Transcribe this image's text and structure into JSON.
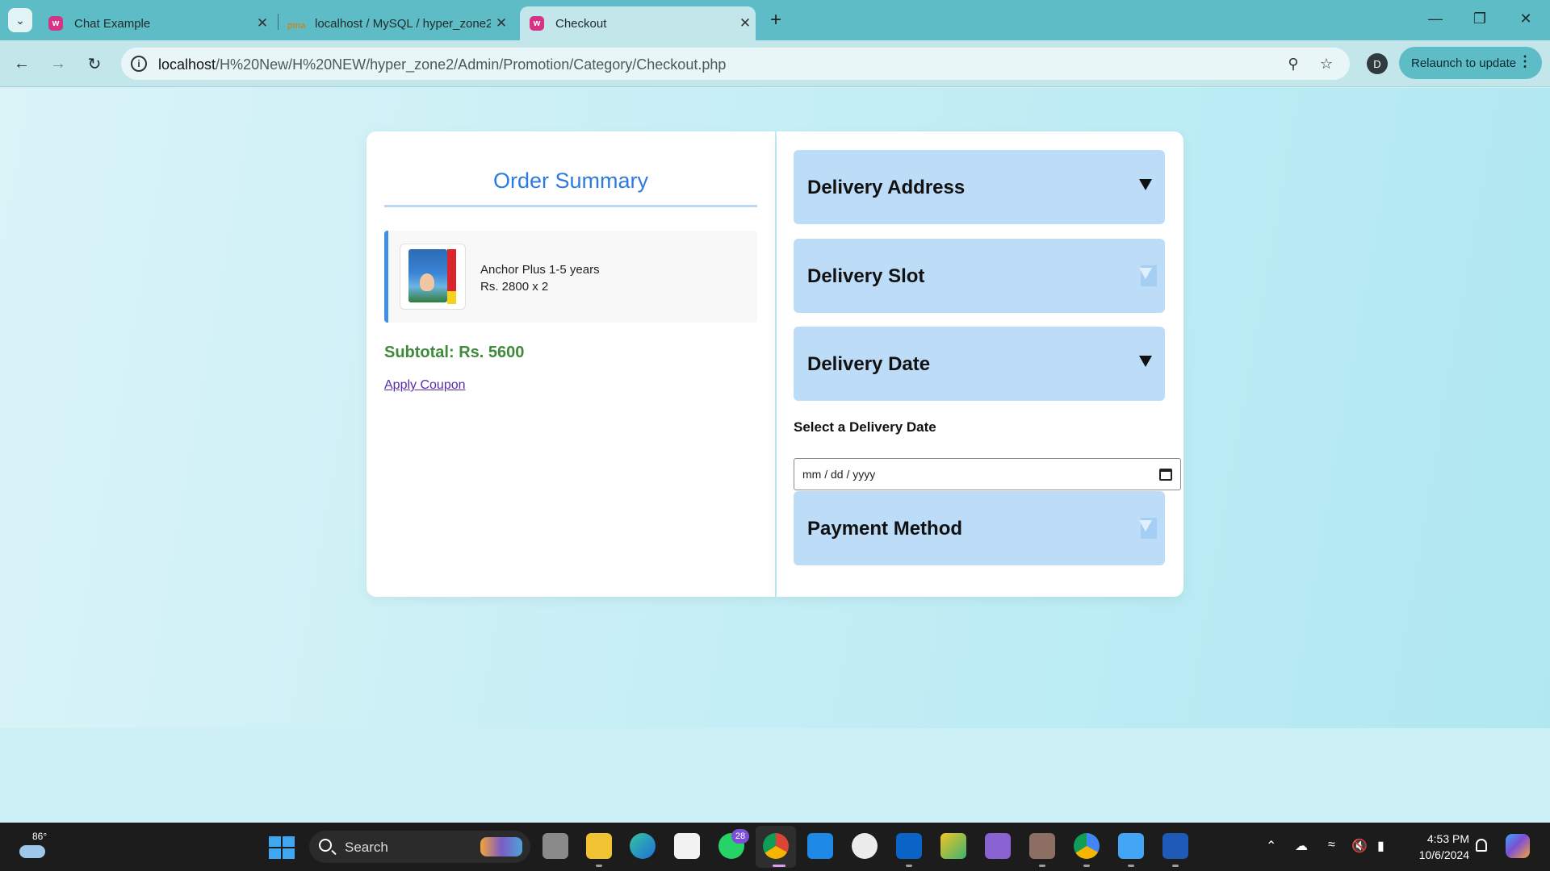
{
  "browser": {
    "tabs": [
      {
        "title": "Chat Example",
        "active": false
      },
      {
        "title": "localhost / MySQL / hyper_zone2",
        "active": false
      },
      {
        "title": "Checkout",
        "active": true
      }
    ],
    "url_host": "localhost",
    "url_path": "/H%20New/H%20NEW/hyper_zone2/Admin/Promotion/Category/Checkout.php",
    "profile_initial": "D",
    "relaunch_label": "Relaunch to update",
    "icons": {
      "menu": "chevron-down-icon",
      "new_tab": "plus-icon",
      "zoom": "zoom-icon",
      "bookmark": "star-icon",
      "more": "kebab-icon"
    }
  },
  "order_summary": {
    "title": "Order Summary",
    "items": [
      {
        "name": "Anchor Plus 1-5 years",
        "price_line": "Rs. 2800 x 2"
      }
    ],
    "subtotal": "Subtotal: Rs. 5600",
    "apply_coupon": "Apply Coupon"
  },
  "checkout": {
    "sections": [
      {
        "title": "Delivery Address",
        "arrow": "dark"
      },
      {
        "title": "Delivery Slot",
        "arrow": "faded"
      },
      {
        "title": "Delivery Date",
        "arrow": "dark"
      },
      {
        "title": "Payment Method",
        "arrow": "faded"
      }
    ],
    "date_label": "Select a Delivery Date",
    "date_placeholder": "mm / dd / yyyy"
  },
  "taskbar": {
    "weather_temp": "86°",
    "search_label": "Search",
    "whatsapp_badge": "28",
    "time": "4:53 PM",
    "date": "10/6/2024",
    "colors": {
      "accent": "#3fa6f2"
    }
  },
  "colors": {
    "title_blue": "#2d7be0",
    "subtotal_green": "#3e8a3a",
    "accordion_bg": "#bcdcf8",
    "item_border": "#3f8fe6"
  }
}
